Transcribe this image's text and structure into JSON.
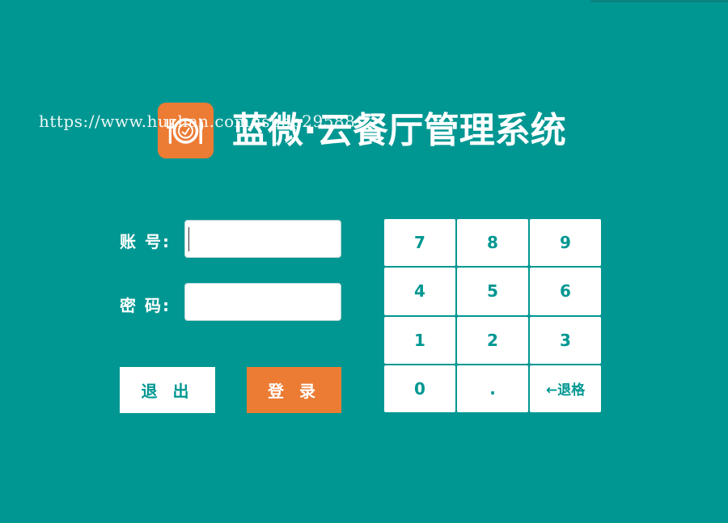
{
  "app": {
    "title": "蓝微·云餐厅管理系统",
    "watermark": "https://www.huzhan.com/ishop29588"
  },
  "form": {
    "account_label": "账 号:",
    "password_label": "密 码:",
    "account_value": "",
    "password_value": ""
  },
  "buttons": {
    "exit_label": "退 出",
    "login_label": "登 录"
  },
  "keypad": {
    "keys": [
      "7",
      "8",
      "9",
      "4",
      "5",
      "6",
      "1",
      "2",
      "3",
      "0",
      ".",
      "←退格"
    ]
  },
  "colors": {
    "background": "#009792",
    "accent": "#ec7b33",
    "white": "#ffffff"
  },
  "icons": {
    "logo": "plate-fork-knife-icon"
  }
}
